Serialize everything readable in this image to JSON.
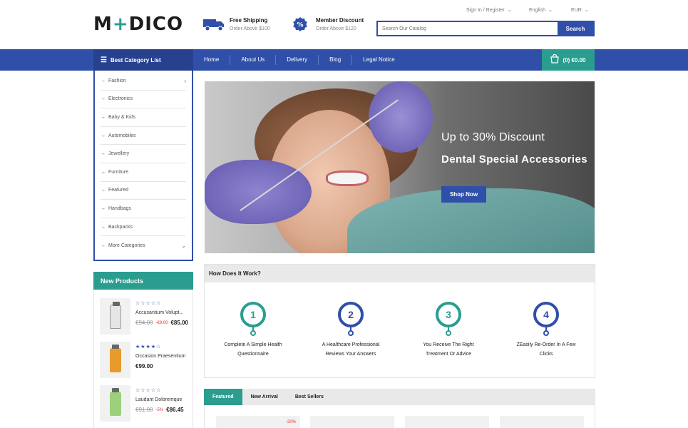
{
  "logo": {
    "pre": "M",
    "plus": "+",
    "rest": "DICO"
  },
  "features": [
    {
      "title": "Free Shipping",
      "sub": "Order Above $100",
      "icon": "truck-icon"
    },
    {
      "title": "Member Discount",
      "sub": "Order Above $120",
      "icon": "percent-badge-icon"
    }
  ],
  "toplinks": {
    "account": "Sign In / Register",
    "language": "English",
    "currency": "EUR"
  },
  "search": {
    "placeholder": "Search Our Catalog",
    "button": "Search"
  },
  "nav": {
    "category_label": "Best Category List",
    "links": [
      "Home",
      "About Us",
      "Delivery",
      "Blog",
      "Legal Notice"
    ],
    "cart": "(0) €0.00"
  },
  "categories": [
    "Fashion",
    "Electronics",
    "Baby & Kids",
    "Automobiles",
    "Jewellery",
    "Furniture",
    "Featured",
    "Handbags",
    "Backpacks",
    "More Categories"
  ],
  "new_products": {
    "title": "New Products",
    "items": [
      {
        "name": "Accusantium Volupt...",
        "rating": 0,
        "stars": "☆☆☆☆☆",
        "old": "€94.00",
        "disc": "-€9.00",
        "price": "€85.00",
        "bottle": "#e6e6e6"
      },
      {
        "name": "Occasion Praesentium",
        "rating": 4,
        "stars": "★★★★☆",
        "old": "",
        "disc": "",
        "price": "€99.00",
        "bottle": "#e89b2c"
      },
      {
        "name": "Laudant Doloremque",
        "rating": 0,
        "stars": "☆☆☆☆☆",
        "old": "€91.00",
        "disc": "-5%",
        "price": "€86.45",
        "bottle": "#9dd07a"
      }
    ]
  },
  "banner": {
    "sub": "Up to 30% Discount",
    "title": "Dental Special Accessories",
    "button": "Shop Now"
  },
  "how": {
    "title": "How Does It Work?",
    "steps": [
      {
        "num": "1",
        "line1": "Complete A Simple Health",
        "line2": "Questionnaire",
        "color": "#2a9d8f"
      },
      {
        "num": "2",
        "line1": "A Healthcare Professional",
        "line2": "Reviews Your Answers",
        "color": "#2f4fa8"
      },
      {
        "num": "3",
        "line1": "You Receive The Right",
        "line2": "Treatment Or Advice",
        "color": "#2a9d8f"
      },
      {
        "num": "4",
        "line1": "ZEasily Re-Order In A Few",
        "line2": "Clicks",
        "color": "#2f4fa8"
      }
    ]
  },
  "tabs": [
    "Featured",
    "New Arrival",
    "Best Sellers"
  ],
  "products": [
    {
      "badge": "-20%"
    },
    {
      "badge": ""
    },
    {
      "badge": ""
    },
    {
      "badge": ""
    }
  ],
  "colors": {
    "primary": "#2f4fa8",
    "accent": "#2a9d8f",
    "sale": "#e03131"
  }
}
